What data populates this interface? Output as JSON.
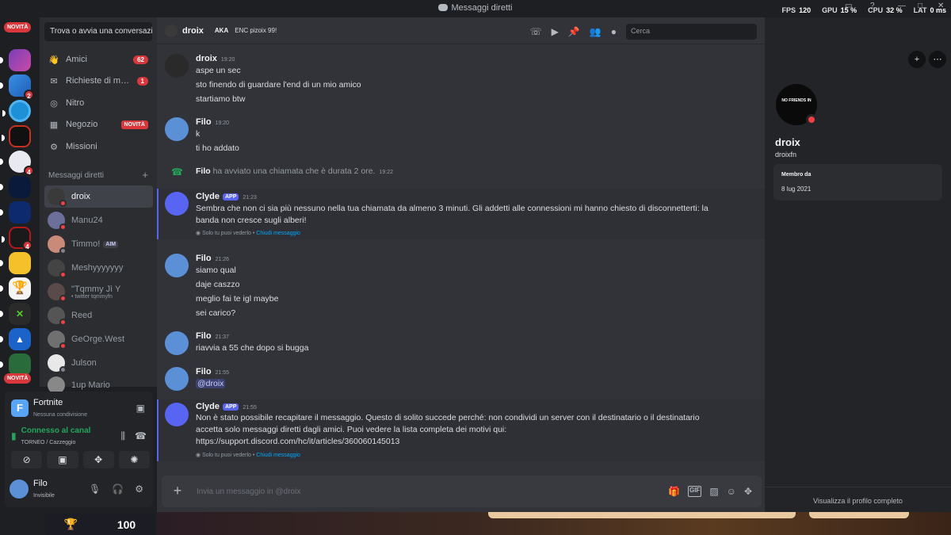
{
  "window": {
    "title": "Messaggi diretti"
  },
  "overlay": {
    "fps_label": "FPS",
    "fps": "120",
    "gpu_label": "GPU",
    "gpu": "15 %",
    "cpu_label": "CPU",
    "cpu": "32 %",
    "lat_label": "LAT",
    "lat": "0 ms"
  },
  "rail": {
    "new_label": "NOVITÀ",
    "new_label_bottom": "NOVITÀ",
    "badges": [
      "2",
      "4",
      "4"
    ]
  },
  "sidebar": {
    "search_label": "Trova o avvia una conversazione",
    "nav": [
      {
        "label": "Amici",
        "count": "62"
      },
      {
        "label": "Richieste di messaggi",
        "count": "1"
      },
      {
        "label": "Nitro"
      },
      {
        "label": "Negozio",
        "tag": "NOVITÀ"
      },
      {
        "label": "Missioni"
      }
    ],
    "dm_header": "Messaggi diretti",
    "dms": [
      {
        "name": "droix"
      },
      {
        "name": "Manu24"
      },
      {
        "name": "Timmo!",
        "tag": "AIM"
      },
      {
        "name": "Meshyyyyyyy"
      },
      {
        "name": "\"Tqmmy Jì Y",
        "sub": "• twitter tqmmyfn"
      },
      {
        "name": "Reed"
      },
      {
        "name": "GeOrge.West"
      },
      {
        "name": "Julson"
      },
      {
        "name": "1up Mario"
      }
    ]
  },
  "panel": {
    "game_title": "Fortnite",
    "game_status": "Nessuna condivisione",
    "voice_title": "Connesso al canal",
    "voice_sub": "TORNEO / Cazzeggio",
    "user_name": "Filo",
    "user_status": "Invisibile",
    "trophies": "100"
  },
  "chat": {
    "header_name": "droix",
    "aka_label": "AKA",
    "aka_value": "ENC pizoix 99!",
    "search_placeholder": "Cerca",
    "composer_placeholder": "Invia un messaggio in @droix",
    "messages": [
      {
        "author": "droix",
        "time": "19:20",
        "lines": [
          "aspe un sec",
          "sto finendo di guardare l'end di un mio amico",
          "startiamo btw"
        ]
      },
      {
        "author": "Filo",
        "time": "19:20",
        "lines": [
          "k",
          "ti ho addato"
        ]
      },
      {
        "system_author": "Filo",
        "system_text": " ha avviato una chiamata che è durata 2 ore.",
        "time": "19:22"
      },
      {
        "author": "Clyde",
        "app": "APP",
        "time": "21:23",
        "lines": [
          "Sembra che non ci sia più nessuno nella tua chiamata da almeno 3 minuti. Gli addetti alle connessioni mi hanno chiesto di disconnetterti: la",
          "banda non cresce sugli alberi!"
        ],
        "note": "Solo tu puoi vederlo",
        "note_sep": " • ",
        "note_link": "Chiudi messaggio"
      },
      {
        "author": "Filo",
        "time": "21:26",
        "lines": [
          "siamo qual",
          "daje caszzo",
          "meglio fai te igl maybe",
          "sei carico?"
        ]
      },
      {
        "author": "Filo",
        "time": "21:37",
        "lines": [
          "riavvia a 55 che dopo si bugga"
        ]
      },
      {
        "author": "Filo",
        "time": "21:55",
        "mention": "@droix"
      },
      {
        "author": "Clyde",
        "app": "APP",
        "time": "21:55",
        "lines": [
          "Non è stato possibile recapitare il messaggio. Questo di solito succede perché: non condividi un server con il destinatario o il destinatario",
          "accetta solo messaggi diretti dagli amici. Puoi vedere la lista completa dei motivi qui:"
        ],
        "link": "https://support.discord.com/hc/it/articles/360060145013",
        "note": "Solo tu puoi vederlo",
        "note_sep": " • ",
        "note_link": "Chiudi messaggio"
      }
    ]
  },
  "profile": {
    "name": "droix",
    "username": "droixfn",
    "member_label": "Membro da",
    "member_date": "8 lug 2021",
    "avatar_text": "NO FRIENDS IN",
    "full_profile": "Visualizza il profilo completo"
  },
  "colors": {
    "accent": "#5865f2",
    "danger": "#da373c",
    "online": "#23a55a",
    "link": "#00a8fc"
  }
}
